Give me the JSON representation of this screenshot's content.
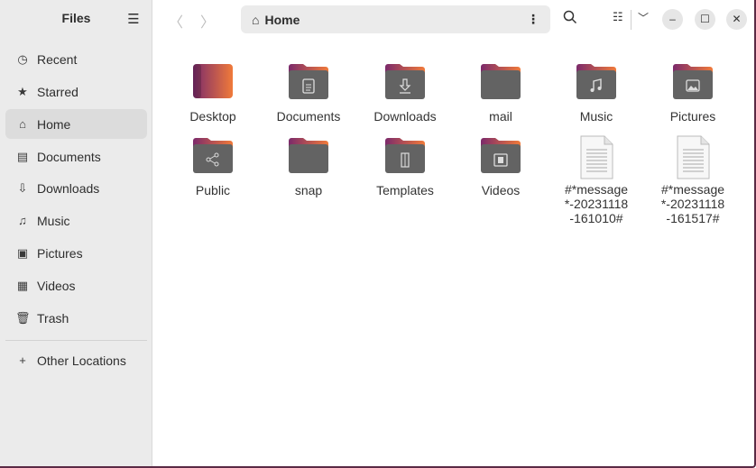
{
  "sidebar": {
    "title": "Files",
    "items": [
      {
        "label": "Recent",
        "icon": "recent-icon",
        "glyph": "◷"
      },
      {
        "label": "Starred",
        "icon": "star-icon",
        "glyph": "★"
      },
      {
        "label": "Home",
        "icon": "home-icon",
        "glyph": "⌂"
      },
      {
        "label": "Documents",
        "icon": "document-icon",
        "glyph": "▤"
      },
      {
        "label": "Downloads",
        "icon": "download-icon",
        "glyph": "⇩"
      },
      {
        "label": "Music",
        "icon": "music-icon",
        "glyph": "♫"
      },
      {
        "label": "Pictures",
        "icon": "picture-icon",
        "glyph": "▣"
      },
      {
        "label": "Videos",
        "icon": "video-icon",
        "glyph": "▦"
      },
      {
        "label": "Trash",
        "icon": "trash-icon",
        "glyph": "🗑"
      }
    ],
    "other_locations": "Other Locations",
    "selected": "Home"
  },
  "header": {
    "path": "Home"
  },
  "files": [
    {
      "name": "Desktop",
      "type": "desktop"
    },
    {
      "name": "Documents",
      "type": "folder",
      "glyph": "document"
    },
    {
      "name": "Downloads",
      "type": "folder",
      "glyph": "download"
    },
    {
      "name": "mail",
      "type": "folder"
    },
    {
      "name": "Music",
      "type": "folder",
      "glyph": "music"
    },
    {
      "name": "Pictures",
      "type": "folder",
      "glyph": "picture"
    },
    {
      "name": "Public",
      "type": "folder",
      "glyph": "share"
    },
    {
      "name": "snap",
      "type": "folder"
    },
    {
      "name": "Templates",
      "type": "folder",
      "glyph": "template"
    },
    {
      "name": "Videos",
      "type": "folder",
      "glyph": "video"
    },
    {
      "name": "#*message*-20231118-161010#",
      "type": "text"
    },
    {
      "name": "#*message*-20231118-161517#",
      "type": "text"
    }
  ],
  "colors": {
    "accent_start": "#7b2a6b",
    "accent_end": "#f07a3a",
    "folder_body": "#636363"
  }
}
